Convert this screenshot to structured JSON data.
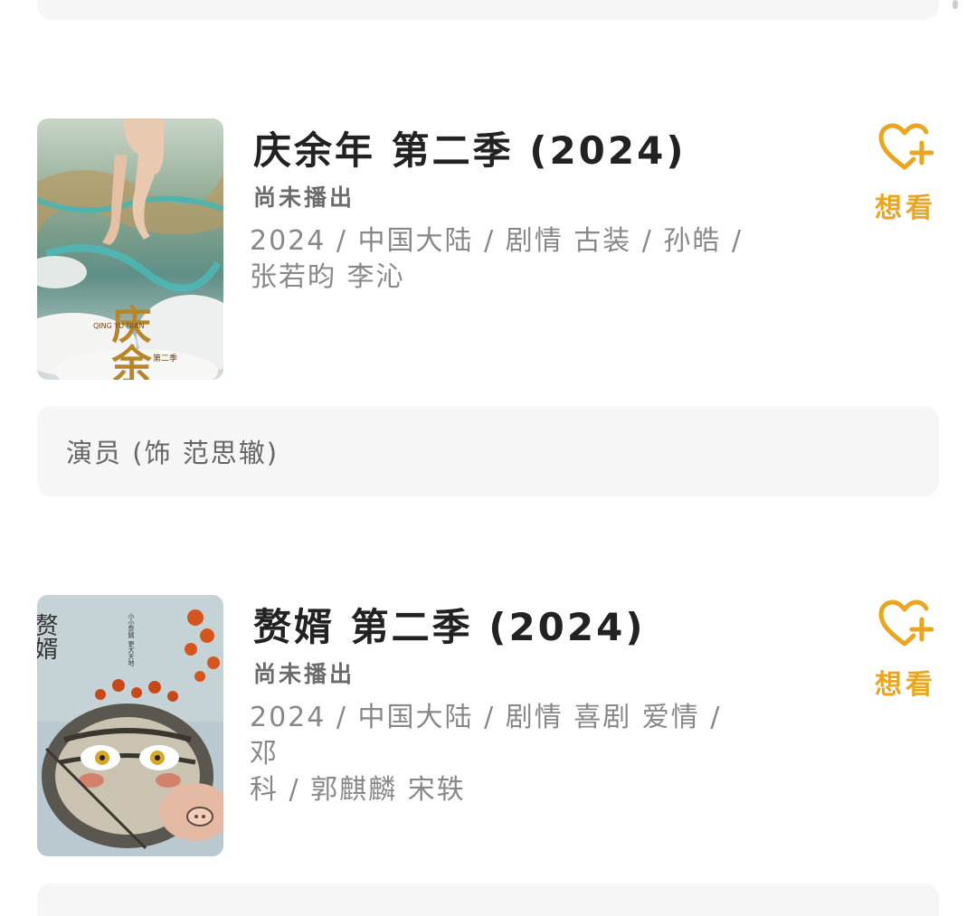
{
  "items": [
    {
      "title": "庆余年 第二季 (2024)",
      "status": "尚未播出",
      "meta_line1": "2024 / 中国大陆 / 剧情 古装 / 孙皓 /",
      "meta_line2": "张若昀 李沁",
      "want_label": "想看",
      "role_note": "演员 (饰 范思辙)",
      "poster_text": {
        "vertical_title": "庆余年",
        "pinyin": "QING YU NIAN",
        "season_tag": "第二季"
      }
    },
    {
      "title": "赘婿 第二季 (2024)",
      "status": "尚未播出",
      "meta_line1": "2024 / 中国大陆 / 剧情 喜剧 爱情 / 邓",
      "meta_line2": "科 / 郭麒麟 宋轶",
      "want_label": "想看",
      "poster_text": {
        "vertical_title": "赘婿",
        "tagline": "小小赘婿 更大天地"
      }
    }
  ],
  "colors": {
    "accent": "#e8a622",
    "title": "#222222",
    "meta": "#888888",
    "note_bg": "#f6f6f6"
  },
  "icons": {
    "want": "heart-plus-icon"
  }
}
